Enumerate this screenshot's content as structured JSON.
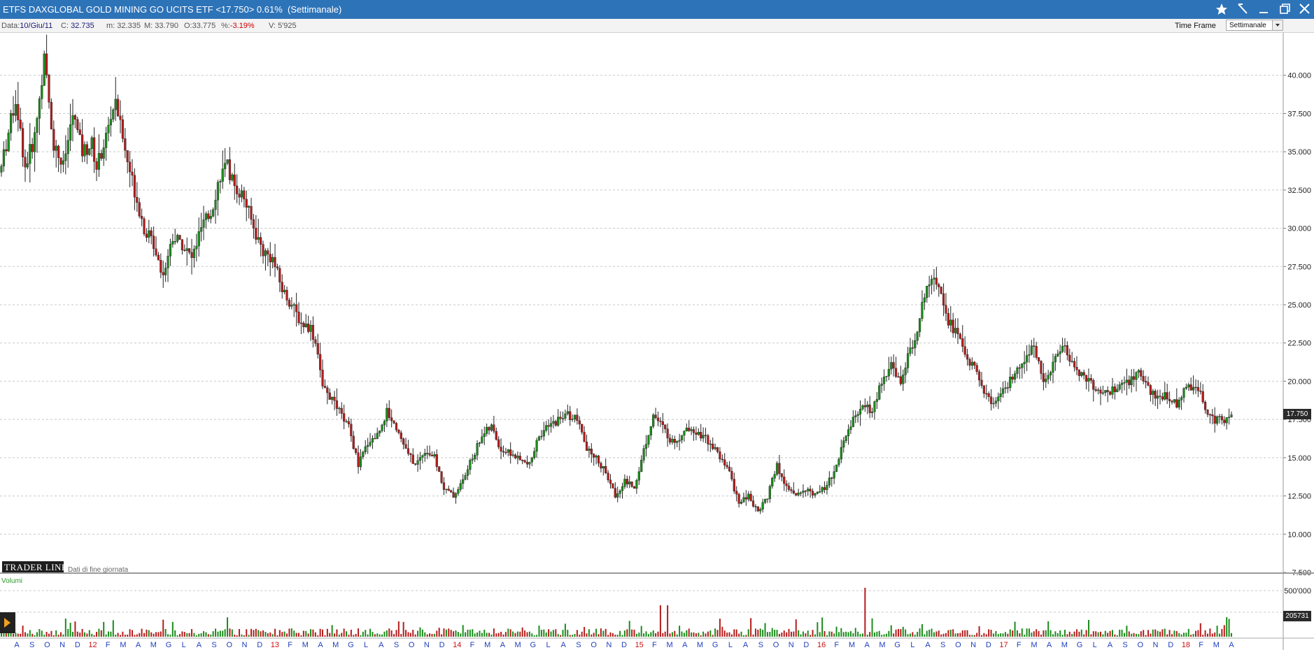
{
  "window": {
    "title": "ETFS DAXGLOBAL GOLD MINING GO UCITS ETF <17.750> 0.61%",
    "period": "(Settimanale)",
    "buttons": [
      "star-icon",
      "drawing-tool-icon",
      "minimize-icon",
      "restore-icon",
      "close-icon"
    ]
  },
  "infobar": {
    "date_label": "Data:",
    "date_value": "10/Giu/11",
    "close_label": "C:",
    "close_value": "32.735",
    "min_label": "m:",
    "min_value": "32.335",
    "max_label": "M:",
    "max_value": "33.790",
    "open_label": "O:",
    "open_value": "33.775",
    "pct_label": "%:",
    "pct_value": "-3.19%",
    "vol_label": "V:",
    "vol_value": "5'925",
    "timeframe_label": "Time Frame",
    "timeframe_value": "Settimanale"
  },
  "logo": {
    "brand": "TRADER LINK",
    "subtitle": "Dati di fine giornata"
  },
  "volume_pane": {
    "label": "Volumi",
    "last_value": "205731"
  },
  "colors": {
    "up": "#1a8c1a",
    "down": "#b51c1c",
    "title_bar": "#2d73b8",
    "axis_blue": "#1f3fbf",
    "axis_red": "#cc1111"
  },
  "chart_data": {
    "type": "candlestick",
    "ylim": [
      7.5,
      42.5
    ],
    "y_ticks": [
      "40.000",
      "37.500",
      "35.000",
      "32.500",
      "30.000",
      "27.500",
      "25.000",
      "22.500",
      "20.000",
      "17.500",
      "15.000",
      "12.500",
      "10.000",
      "7.500"
    ],
    "last_price": "17.750",
    "volume_ticks": [
      "500'000"
    ],
    "x_labels": [
      {
        "t": "A",
        "year": false
      },
      {
        "t": "S",
        "year": false
      },
      {
        "t": "O",
        "year": false
      },
      {
        "t": "N",
        "year": false
      },
      {
        "t": "D",
        "year": false
      },
      {
        "t": "12",
        "year": true
      },
      {
        "t": "F",
        "year": false
      },
      {
        "t": "M",
        "year": false
      },
      {
        "t": "A",
        "year": false
      },
      {
        "t": "M",
        "year": false
      },
      {
        "t": "G",
        "year": false
      },
      {
        "t": "L",
        "year": false
      },
      {
        "t": "A",
        "year": false
      },
      {
        "t": "S",
        "year": false
      },
      {
        "t": "O",
        "year": false
      },
      {
        "t": "N",
        "year": false
      },
      {
        "t": "D",
        "year": false
      },
      {
        "t": "13",
        "year": true
      },
      {
        "t": "F",
        "year": false
      },
      {
        "t": "M",
        "year": false
      },
      {
        "t": "A",
        "year": false
      },
      {
        "t": "M",
        "year": false
      },
      {
        "t": "G",
        "year": false
      },
      {
        "t": "L",
        "year": false
      },
      {
        "t": "A",
        "year": false
      },
      {
        "t": "S",
        "year": false
      },
      {
        "t": "O",
        "year": false
      },
      {
        "t": "N",
        "year": false
      },
      {
        "t": "D",
        "year": false
      },
      {
        "t": "14",
        "year": true
      },
      {
        "t": "F",
        "year": false
      },
      {
        "t": "M",
        "year": false
      },
      {
        "t": "A",
        "year": false
      },
      {
        "t": "M",
        "year": false
      },
      {
        "t": "G",
        "year": false
      },
      {
        "t": "L",
        "year": false
      },
      {
        "t": "A",
        "year": false
      },
      {
        "t": "S",
        "year": false
      },
      {
        "t": "O",
        "year": false
      },
      {
        "t": "N",
        "year": false
      },
      {
        "t": "D",
        "year": false
      },
      {
        "t": "15",
        "year": true
      },
      {
        "t": "F",
        "year": false
      },
      {
        "t": "M",
        "year": false
      },
      {
        "t": "A",
        "year": false
      },
      {
        "t": "M",
        "year": false
      },
      {
        "t": "G",
        "year": false
      },
      {
        "t": "L",
        "year": false
      },
      {
        "t": "A",
        "year": false
      },
      {
        "t": "S",
        "year": false
      },
      {
        "t": "O",
        "year": false
      },
      {
        "t": "N",
        "year": false
      },
      {
        "t": "D",
        "year": false
      },
      {
        "t": "16",
        "year": true
      },
      {
        "t": "F",
        "year": false
      },
      {
        "t": "M",
        "year": false
      },
      {
        "t": "A",
        "year": false
      },
      {
        "t": "M",
        "year": false
      },
      {
        "t": "G",
        "year": false
      },
      {
        "t": "L",
        "year": false
      },
      {
        "t": "A",
        "year": false
      },
      {
        "t": "S",
        "year": false
      },
      {
        "t": "O",
        "year": false
      },
      {
        "t": "N",
        "year": false
      },
      {
        "t": "D",
        "year": false
      },
      {
        "t": "17",
        "year": true
      },
      {
        "t": "F",
        "year": false
      },
      {
        "t": "M",
        "year": false
      },
      {
        "t": "A",
        "year": false
      },
      {
        "t": "M",
        "year": false
      },
      {
        "t": "G",
        "year": false
      },
      {
        "t": "L",
        "year": false
      },
      {
        "t": "A",
        "year": false
      },
      {
        "t": "S",
        "year": false
      },
      {
        "t": "O",
        "year": false
      },
      {
        "t": "N",
        "year": false
      },
      {
        "t": "D",
        "year": false
      },
      {
        "t": "18",
        "year": true
      },
      {
        "t": "F",
        "year": false
      },
      {
        "t": "M",
        "year": false
      },
      {
        "t": "A",
        "year": false
      }
    ],
    "close_anchors": [
      [
        0,
        34.0
      ],
      [
        6,
        38.5
      ],
      [
        10,
        34.0
      ],
      [
        14,
        36.0
      ],
      [
        18,
        41.0
      ],
      [
        22,
        35.5
      ],
      [
        26,
        34.0
      ],
      [
        30,
        37.5
      ],
      [
        34,
        35.0
      ],
      [
        38,
        35.5
      ],
      [
        40,
        34.0
      ],
      [
        44,
        36.0
      ],
      [
        48,
        38.5
      ],
      [
        52,
        35.0
      ],
      [
        56,
        32.5
      ],
      [
        60,
        30.0
      ],
      [
        64,
        29.0
      ],
      [
        68,
        27.0
      ],
      [
        72,
        29.5
      ],
      [
        76,
        29.0
      ],
      [
        80,
        28.0
      ],
      [
        84,
        30.0
      ],
      [
        88,
        31.0
      ],
      [
        92,
        33.5
      ],
      [
        95,
        34.0
      ],
      [
        98,
        32.8
      ],
      [
        102,
        32.0
      ],
      [
        106,
        30.0
      ],
      [
        110,
        28.5
      ],
      [
        114,
        28.0
      ],
      [
        118,
        26.0
      ],
      [
        122,
        25.0
      ],
      [
        126,
        23.8
      ],
      [
        130,
        23.5
      ],
      [
        133,
        22.0
      ],
      [
        135,
        19.5
      ],
      [
        138,
        19.0
      ],
      [
        142,
        18.0
      ],
      [
        146,
        17.0
      ],
      [
        150,
        14.5
      ],
      [
        154,
        16.0
      ],
      [
        158,
        16.5
      ],
      [
        162,
        18.0
      ],
      [
        166,
        17.0
      ],
      [
        170,
        15.5
      ],
      [
        174,
        14.5
      ],
      [
        178,
        15.5
      ],
      [
        182,
        15.0
      ],
      [
        186,
        13.0
      ],
      [
        190,
        12.5
      ],
      [
        194,
        13.5
      ],
      [
        198,
        15.0
      ],
      [
        202,
        16.5
      ],
      [
        206,
        17.0
      ],
      [
        210,
        15.5
      ],
      [
        214,
        15.3
      ],
      [
        218,
        14.8
      ],
      [
        222,
        14.5
      ],
      [
        226,
        16.5
      ],
      [
        230,
        17.0
      ],
      [
        234,
        17.5
      ],
      [
        238,
        17.8
      ],
      [
        242,
        17.5
      ],
      [
        246,
        15.5
      ],
      [
        250,
        15.0
      ],
      [
        254,
        14.0
      ],
      [
        258,
        12.5
      ],
      [
        262,
        13.5
      ],
      [
        266,
        13.0
      ],
      [
        270,
        15.5
      ],
      [
        274,
        17.8
      ],
      [
        278,
        17.0
      ],
      [
        282,
        16.0
      ],
      [
        286,
        16.5
      ],
      [
        290,
        17.0
      ],
      [
        294,
        16.5
      ],
      [
        298,
        16.0
      ],
      [
        302,
        15.0
      ],
      [
        306,
        14.0
      ],
      [
        310,
        12.0
      ],
      [
        314,
        12.5
      ],
      [
        318,
        11.5
      ],
      [
        322,
        12.5
      ],
      [
        326,
        14.5
      ],
      [
        330,
        13.0
      ],
      [
        334,
        12.5
      ],
      [
        338,
        13.0
      ],
      [
        342,
        12.5
      ],
      [
        346,
        13.0
      ],
      [
        350,
        14.0
      ],
      [
        354,
        16.0
      ],
      [
        358,
        17.5
      ],
      [
        362,
        18.5
      ],
      [
        366,
        18.0
      ],
      [
        370,
        20.0
      ],
      [
        374,
        21.0
      ],
      [
        378,
        20.0
      ],
      [
        382,
        22.0
      ],
      [
        386,
        24.0
      ],
      [
        389,
        26.5
      ],
      [
        392,
        27.0
      ],
      [
        395,
        26.0
      ],
      [
        398,
        24.0
      ],
      [
        402,
        23.0
      ],
      [
        406,
        21.5
      ],
      [
        410,
        20.5
      ],
      [
        414,
        19.0
      ],
      [
        418,
        18.5
      ],
      [
        422,
        19.5
      ],
      [
        426,
        20.5
      ],
      [
        430,
        21.0
      ],
      [
        434,
        22.5
      ],
      [
        438,
        20.0
      ],
      [
        442,
        21.0
      ],
      [
        446,
        22.5
      ],
      [
        450,
        21.0
      ],
      [
        454,
        20.5
      ],
      [
        458,
        20.0
      ],
      [
        462,
        19.0
      ],
      [
        466,
        19.3
      ],
      [
        470,
        19.5
      ],
      [
        474,
        20.0
      ],
      [
        478,
        20.5
      ],
      [
        482,
        19.5
      ],
      [
        486,
        19.0
      ],
      [
        490,
        19.0
      ],
      [
        494,
        18.5
      ],
      [
        498,
        19.5
      ],
      [
        502,
        19.8
      ],
      [
        504,
        19.5
      ],
      [
        506,
        18.0
      ],
      [
        510,
        17.5
      ],
      [
        514,
        17.5
      ],
      [
        517,
        17.75
      ]
    ],
    "ohlc_note": "Weekly OHLC bars, first bar week of 10/Giu/11, last close 17.750"
  }
}
